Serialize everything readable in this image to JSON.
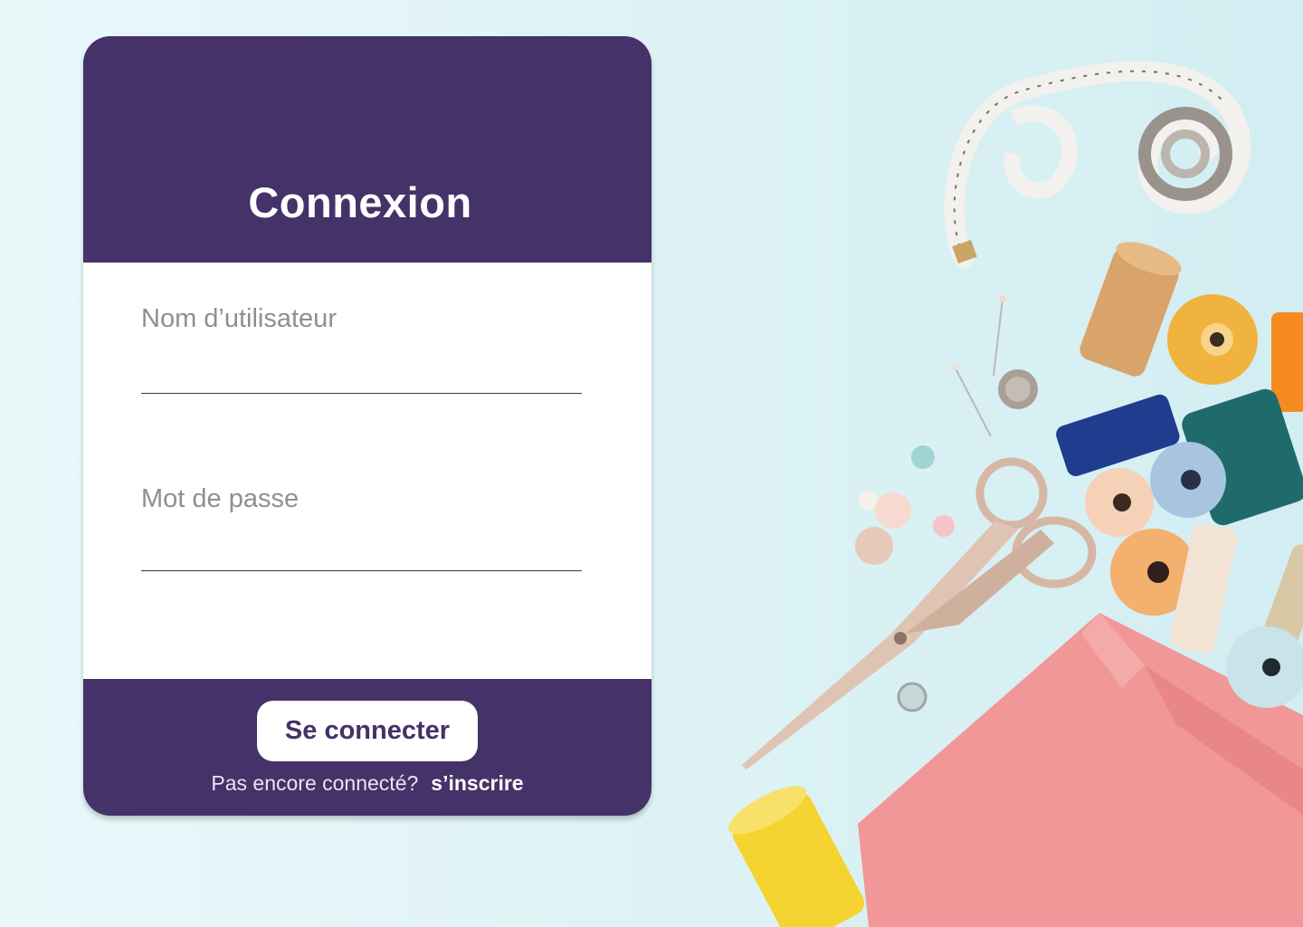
{
  "login_card": {
    "title": "Connexion",
    "username_label": "Nom d’utilisateur",
    "username_value": "",
    "password_label": "Mot de passe",
    "password_value": "",
    "submit_label": "Se connecter",
    "signup_prompt": "Pas encore connecté?",
    "signup_link": "s’inscrire"
  },
  "colors": {
    "brand": "#443268",
    "card": "#ffffff",
    "background": "#d9f0f3"
  },
  "illustration": {
    "subject": "sewing-supplies-photo"
  }
}
